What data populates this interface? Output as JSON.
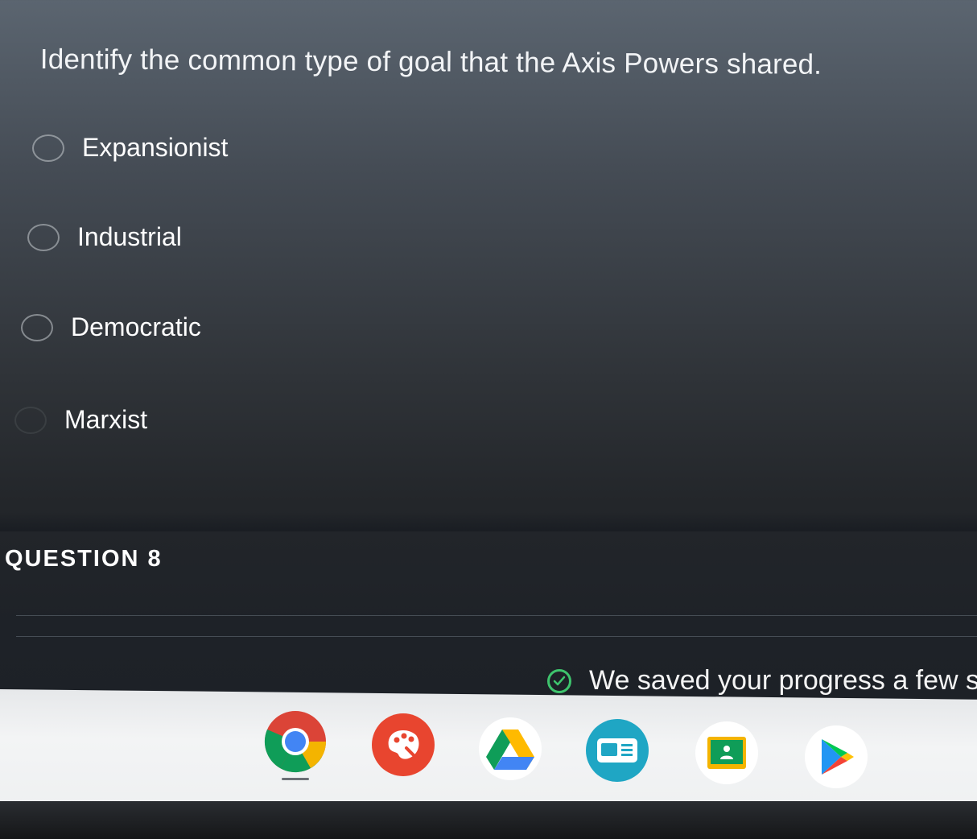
{
  "question": {
    "text": "Identify the common type of goal that the Axis Powers shared.",
    "options": [
      {
        "label": "Expansionist"
      },
      {
        "label": "Industrial"
      },
      {
        "label": "Democratic"
      },
      {
        "label": "Marxist"
      }
    ]
  },
  "next_question": {
    "heading": "QUESTION 8"
  },
  "save_status": {
    "text": "We saved your progress a few s",
    "icon": "check-circle-icon",
    "color": "#3ec46d"
  },
  "shelf": {
    "apps": [
      {
        "name": "chrome-icon"
      },
      {
        "name": "canvas-icon"
      },
      {
        "name": "drive-icon"
      },
      {
        "name": "meet-icon"
      },
      {
        "name": "classroom-icon"
      },
      {
        "name": "play-store-icon"
      }
    ]
  }
}
